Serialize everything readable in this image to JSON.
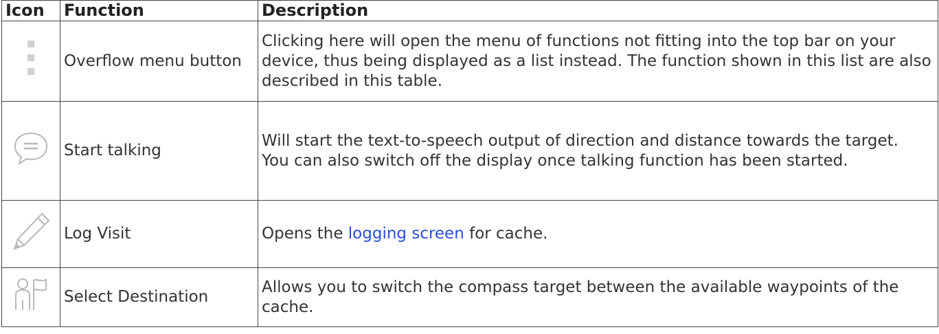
{
  "table": {
    "headers": {
      "icon": "Icon",
      "function": "Function",
      "description": "Description"
    },
    "rows": [
      {
        "icon": "overflow-menu-icon",
        "function": "Overflow menu button",
        "description": "Clicking here will open the menu of functions not fitting into the top bar on your device, thus being displayed as a list instead. The function shown in this list are also described in this table."
      },
      {
        "icon": "speech-bubble-icon",
        "function": "Start talking",
        "description_line1": "Will start the text-to-speech output of direction and distance towards the target.",
        "description_line2": "You can also switch off the display once talking function has been started."
      },
      {
        "icon": "pencil-icon",
        "function": "Log Visit",
        "description_before": "Opens the ",
        "description_link": "logging screen",
        "description_after": " for cache."
      },
      {
        "icon": "person-flag-icon",
        "function": "Select Destination",
        "description": "Allows you to switch the compass target between the available waypoints of the cache."
      }
    ]
  },
  "colors": {
    "border": "#444444",
    "text": "#333333",
    "link": "#2b4fd8",
    "icon": "#b8b8b8"
  }
}
